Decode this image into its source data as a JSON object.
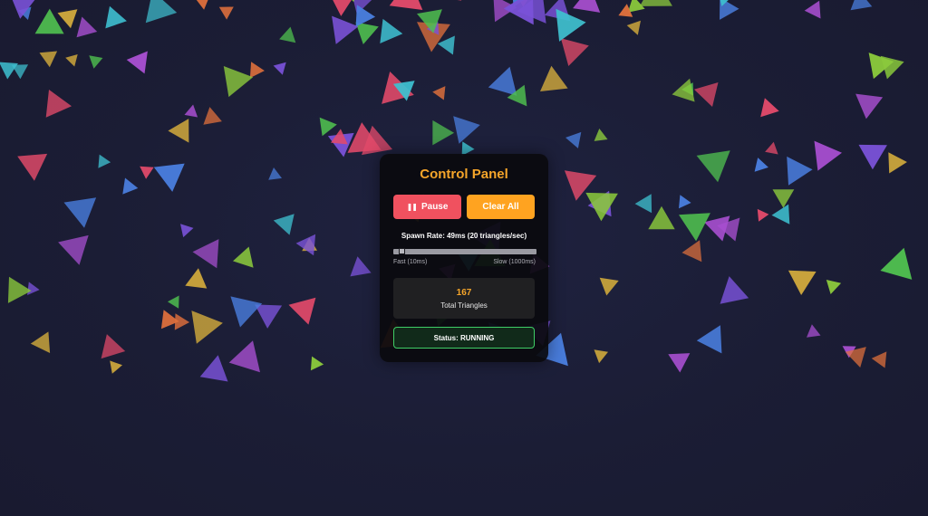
{
  "panel": {
    "title": "Control Panel",
    "pause_label": "Pause",
    "pause_icon": "pause-icon",
    "clear_label": "Clear All",
    "spawn_rate_label": "Spawn Rate: 49ms (20 triangles/sec)",
    "slider": {
      "min_ms": 10,
      "max_ms": 1000,
      "value_ms": 49
    },
    "fast_label": "Fast (10ms)",
    "slow_label": "Slow (1000ms)",
    "count_value": "167",
    "count_label": "Total Triangles",
    "status_label": "Status: RUNNING"
  },
  "colors": {
    "background": "#1b1d33",
    "accent": "#f5a52a",
    "pause_button": "#f0515f",
    "clear_button": "#ffa320",
    "status_border": "#3fce66",
    "triangle_palette": [
      "#4fbf4f",
      "#7a52d8",
      "#4a7fe0",
      "#e24a6a",
      "#cfa83c",
      "#e0703c",
      "#3ebfcf",
      "#8ac83c",
      "#a84fd0"
    ]
  }
}
